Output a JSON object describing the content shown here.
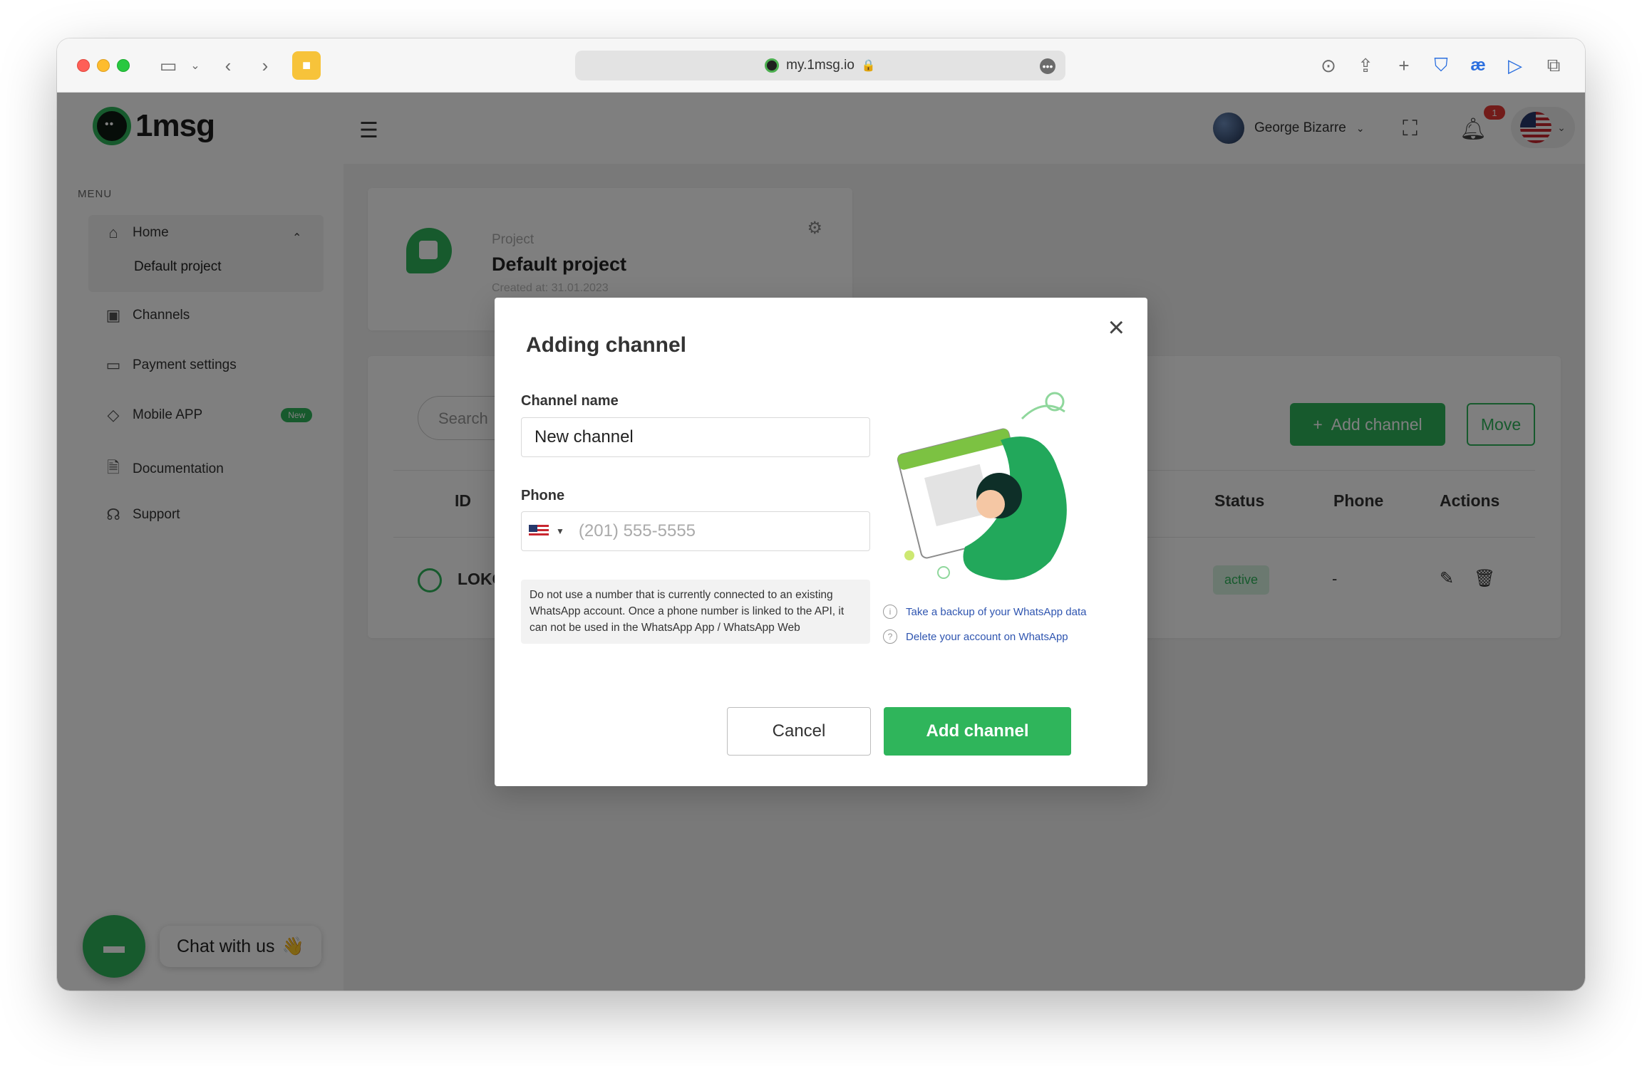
{
  "browser": {
    "url": "my.1msg.io"
  },
  "header": {
    "logo_text": "1msg",
    "user_name": "George Bizarre",
    "notification_count": "1"
  },
  "sidebar": {
    "menu_title": "MENU",
    "items": [
      {
        "label": "Home",
        "icon": "home-icon"
      },
      {
        "label": "Channels",
        "icon": "chip-icon"
      },
      {
        "label": "Payment settings",
        "icon": "card-icon"
      },
      {
        "label": "Mobile APP",
        "icon": "diamond-icon",
        "badge": "New"
      },
      {
        "label": "Documentation",
        "icon": "doc-search-icon"
      },
      {
        "label": "Support",
        "icon": "headset-icon"
      }
    ],
    "home_sub": "Default project"
  },
  "project_card": {
    "label": "Project",
    "name": "Default project",
    "created": "Created at: 31.01.2023"
  },
  "channels_card": {
    "search_placeholder": "Search",
    "add_button": "Add channel",
    "move_button": "Move",
    "columns": {
      "id": "ID",
      "status": "Status",
      "phone": "Phone",
      "actions": "Actions"
    },
    "rows": [
      {
        "id": "LOKG",
        "status": "active",
        "phone": "-"
      }
    ]
  },
  "chat_widget": {
    "label": "Chat with us",
    "emoji": "👋"
  },
  "modal": {
    "title": "Adding channel",
    "channel_name_label": "Channel name",
    "channel_name_value": "New channel",
    "phone_label": "Phone",
    "phone_placeholder": "(201) 555-5555",
    "warning": "Do not use a number that is currently connected to an existing WhatsApp account. Once a phone number is linked to the API, it can not be used in the WhatsApp App / WhatsApp Web",
    "link_backup": "Take a backup of your WhatsApp data",
    "link_delete": "Delete your account on WhatsApp",
    "cancel": "Cancel",
    "submit": "Add channel"
  },
  "colors": {
    "brand_green": "#2fb55b",
    "link_blue": "#2f55b0"
  }
}
